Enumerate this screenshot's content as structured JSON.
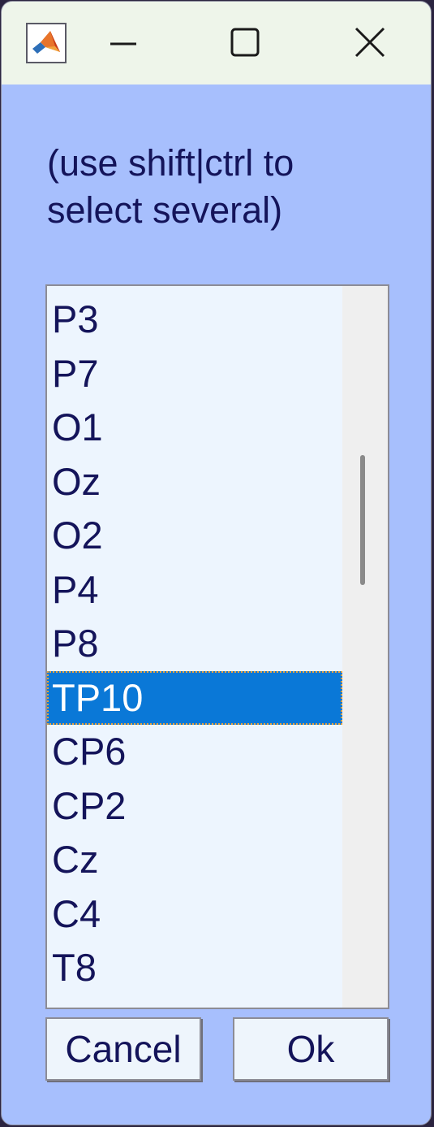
{
  "window": {
    "icon": "matlab-icon",
    "controls": [
      "minimize-icon",
      "maximize-icon",
      "close-icon"
    ]
  },
  "prompt": "(use shift|ctrl to\nselect several)",
  "channel_list": {
    "items": [
      "P3",
      "P7",
      "O1",
      "Oz",
      "O2",
      "P4",
      "P8",
      "TP10",
      "CP6",
      "CP2",
      "Cz",
      "C4",
      "T8"
    ],
    "selected": "TP10"
  },
  "buttons": {
    "cancel_label": "Cancel",
    "ok_label": "Ok"
  },
  "colors": {
    "dialog_background": "#a7bffd",
    "titlebar_background": "#eef5ea",
    "list_background": "#edf5fe",
    "selection": "#0a78d7",
    "text": "#14145a"
  }
}
